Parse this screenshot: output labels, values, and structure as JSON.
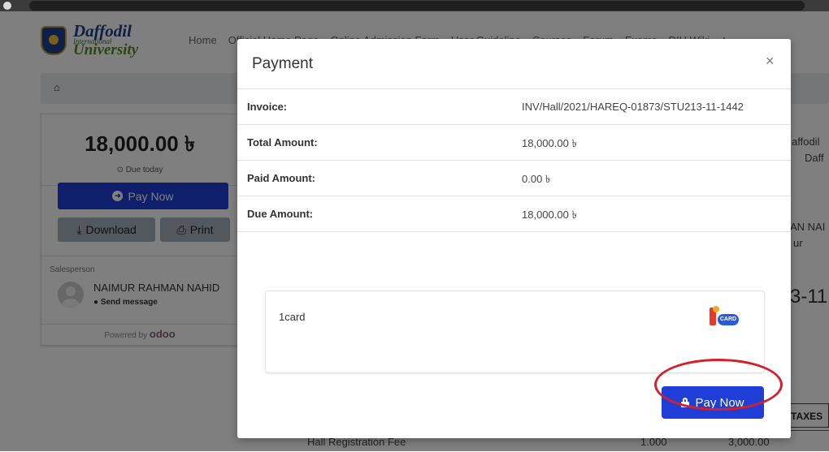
{
  "navbar": {
    "logo_title": "Daffodil",
    "logo_subtitle": "International",
    "logo_university": "University",
    "links": [
      "Home",
      "Official Home Page",
      "Online Admission Form",
      "User Guideline",
      "Courses",
      "Forum",
      "Exams",
      "DIU Wiki"
    ],
    "plus": "+"
  },
  "breadcrumb": {
    "home_icon": "⌂"
  },
  "sidebar_card": {
    "amount": "18,000.00 ৳",
    "due_text": "Due today",
    "pay_now": "Pay Now",
    "download": "Download",
    "print": "Print",
    "salesperson_label": "Salesperson",
    "salesperson_name": "NAIMUR RAHMAN NAHID",
    "send_message": "Send message",
    "powered_by": "Powered by",
    "powered_brand": "odoo"
  },
  "background": {
    "frag_daffodil": "affodil",
    "frag_daff": "Daff",
    "frag_annal": "AN NAI",
    "frag_ur": "ur",
    "frag_big": "3-11",
    "taxes_header": "TAXES",
    "fee_row": {
      "name": "Hall Registration Fee",
      "qty": "1.000",
      "amount": "3,000.00"
    }
  },
  "modal": {
    "title": "Payment",
    "close": "×",
    "rows": [
      {
        "label": "Invoice:",
        "value": "INV/Hall/2021/HAREQ-01873/STU213-11-1442"
      },
      {
        "label": "Total Amount:",
        "value": "18,000.00 ৳"
      },
      {
        "label": "Paid Amount:",
        "value": "0.00 ৳"
      },
      {
        "label": "Due Amount:",
        "value": "18,000.00 ৳"
      }
    ],
    "provider_name": "1card",
    "provider_logo_text": "CARD",
    "pay_button": "Pay Now"
  },
  "colors": {
    "primary": "#1f3ed8",
    "secondary_btn": "#a3b0bd",
    "highlight_circle": "#d3202a"
  }
}
